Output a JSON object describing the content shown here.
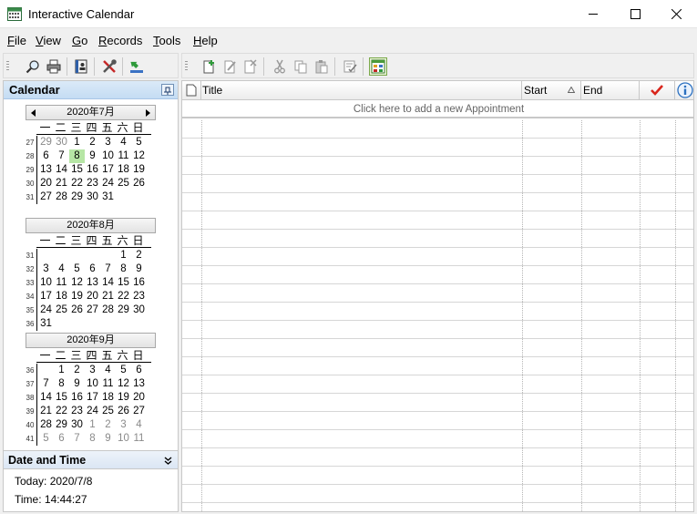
{
  "window": {
    "title": "Interactive Calendar"
  },
  "menu": [
    "File",
    "View",
    "Go",
    "Records",
    "Tools",
    "Help"
  ],
  "calendar_panel": {
    "title": "Calendar"
  },
  "dow": [
    "一",
    "二",
    "三",
    "四",
    "五",
    "六",
    "日"
  ],
  "months": [
    {
      "title": "2020年7月",
      "weeks": [
        {
          "wk": "27",
          "days": [
            "29",
            "30",
            "1",
            "2",
            "3",
            "4",
            "5"
          ],
          "other": [
            0,
            1
          ]
        },
        {
          "wk": "28",
          "days": [
            "6",
            "7",
            "8",
            "9",
            "10",
            "11",
            "12"
          ],
          "today": 2
        },
        {
          "wk": "29",
          "days": [
            "13",
            "14",
            "15",
            "16",
            "17",
            "18",
            "19"
          ]
        },
        {
          "wk": "30",
          "days": [
            "20",
            "21",
            "22",
            "23",
            "24",
            "25",
            "26"
          ]
        },
        {
          "wk": "31",
          "days": [
            "27",
            "28",
            "29",
            "30",
            "31",
            "",
            ""
          ]
        }
      ]
    },
    {
      "title": "2020年8月",
      "weeks": [
        {
          "wk": "31",
          "days": [
            "",
            "",
            "",
            "",
            "",
            "1",
            "2"
          ]
        },
        {
          "wk": "32",
          "days": [
            "3",
            "4",
            "5",
            "6",
            "7",
            "8",
            "9"
          ]
        },
        {
          "wk": "33",
          "days": [
            "10",
            "11",
            "12",
            "13",
            "14",
            "15",
            "16"
          ]
        },
        {
          "wk": "34",
          "days": [
            "17",
            "18",
            "19",
            "20",
            "21",
            "22",
            "23"
          ]
        },
        {
          "wk": "35",
          "days": [
            "24",
            "25",
            "26",
            "27",
            "28",
            "29",
            "30"
          ]
        },
        {
          "wk": "36",
          "days": [
            "31",
            "",
            "",
            "",
            "",
            "",
            ""
          ]
        }
      ]
    },
    {
      "title": "2020年9月",
      "weeks": [
        {
          "wk": "36",
          "days": [
            "",
            "1",
            "2",
            "3",
            "4",
            "5",
            "6"
          ]
        },
        {
          "wk": "37",
          "days": [
            "7",
            "8",
            "9",
            "10",
            "11",
            "12",
            "13"
          ]
        },
        {
          "wk": "38",
          "days": [
            "14",
            "15",
            "16",
            "17",
            "18",
            "19",
            "20"
          ]
        },
        {
          "wk": "39",
          "days": [
            "21",
            "22",
            "23",
            "24",
            "25",
            "26",
            "27"
          ]
        },
        {
          "wk": "40",
          "days": [
            "28",
            "29",
            "30",
            "1",
            "2",
            "3",
            "4"
          ],
          "other": [
            3,
            4,
            5,
            6
          ]
        },
        {
          "wk": "41",
          "days": [
            "5",
            "6",
            "7",
            "8",
            "9",
            "10",
            "11"
          ],
          "other": [
            0,
            1,
            2,
            3,
            4,
            5,
            6
          ]
        }
      ]
    }
  ],
  "datetime": {
    "title": "Date and Time",
    "today_label": "Today: 2020/7/8",
    "time_label": "Time: 14:44:27"
  },
  "columns": {
    "title": "Title",
    "start": "Start",
    "end": "End"
  },
  "add_prompt": "Click here to add a new Appointment",
  "colors": {
    "header_blue": "#c4dcf3",
    "today_green": "#b6e6a5",
    "check_red": "#d9261c",
    "info_blue": "#2a6fbf"
  }
}
